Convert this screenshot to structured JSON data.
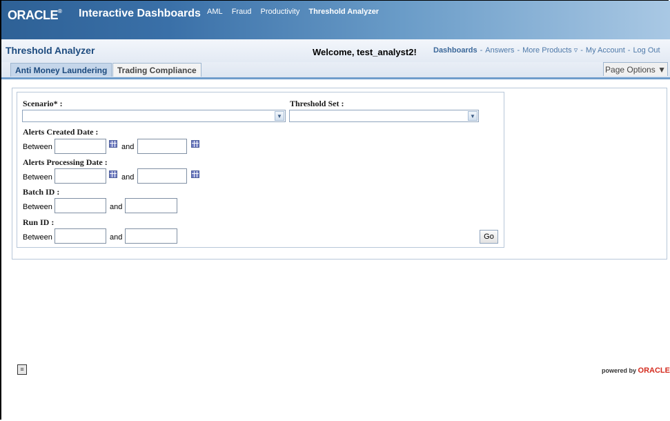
{
  "header": {
    "logo": "ORACLE",
    "product": "Interactive Dashboards",
    "nav": [
      "AML",
      "Fraud",
      "Productivity",
      "Threshold Analyzer"
    ]
  },
  "titlebar": {
    "title": "Threshold Analyzer",
    "welcome": "Welcome, test_analyst2!",
    "links": {
      "dashboards": "Dashboards",
      "answers": "Answers",
      "more_products": "More Products",
      "my_account": "My Account",
      "log_out": "Log Out",
      "separator": "-"
    }
  },
  "tabs": {
    "active": "Anti Money Laundering",
    "inactive": "Trading Compliance",
    "page_options": "Page Options"
  },
  "form": {
    "scenario_label": "Scenario* :",
    "threshold_set_label": "Threshold Set :",
    "alerts_created_label": "Alerts Created Date :",
    "alerts_processing_label": "Alerts Processing Date :",
    "batch_id_label": "Batch ID :",
    "run_id_label": "Run ID :",
    "between": "Between",
    "and": "and",
    "go": "Go"
  },
  "footer": {
    "powered_by": "powered by",
    "oracle": "ORACLE"
  }
}
